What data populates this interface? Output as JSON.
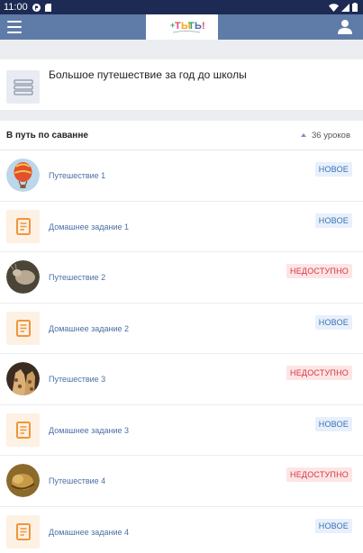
{
  "status_bar": {
    "time": "11:00"
  },
  "logo": {
    "text": "ТЫТЬ!"
  },
  "course": {
    "title": "Большое путешествие за год до школы"
  },
  "section": {
    "title": "В путь по саванне",
    "count": "36 уроков"
  },
  "lessons": [
    {
      "title": "Путешествие 1",
      "badge": "НОВОЕ",
      "icon": "balloon-icon"
    },
    {
      "title": "Домашнее задание 1",
      "badge": "НОВОЕ",
      "icon": "document-icon"
    },
    {
      "title": "Путешествие 2",
      "badge": "НЕДОСТУПНО",
      "icon": "animal-photo"
    },
    {
      "title": "Домашнее задание 2",
      "badge": "НОВОЕ",
      "icon": "document-icon"
    },
    {
      "title": "Путешествие 3",
      "badge": "НЕДОСТУПНО",
      "icon": "giraffe-photo"
    },
    {
      "title": "Домашнее задание 3",
      "badge": "НОВОЕ",
      "icon": "document-icon"
    },
    {
      "title": "Путешествие 4",
      "badge": "НЕДОСТУПНО",
      "icon": "lion-photo"
    },
    {
      "title": "Домашнее задание 4",
      "badge": "НОВОЕ",
      "icon": "document-icon"
    }
  ],
  "colors": {
    "status_bar": "#1d2a53",
    "app_bar": "#5f7ba7",
    "badge_new_text": "#3d6fb2",
    "badge_new_bg": "#e7f0fb",
    "badge_locked_text": "#d9363e",
    "badge_locked_bg": "#fde5e6",
    "doc_icon": "#f0953a"
  }
}
